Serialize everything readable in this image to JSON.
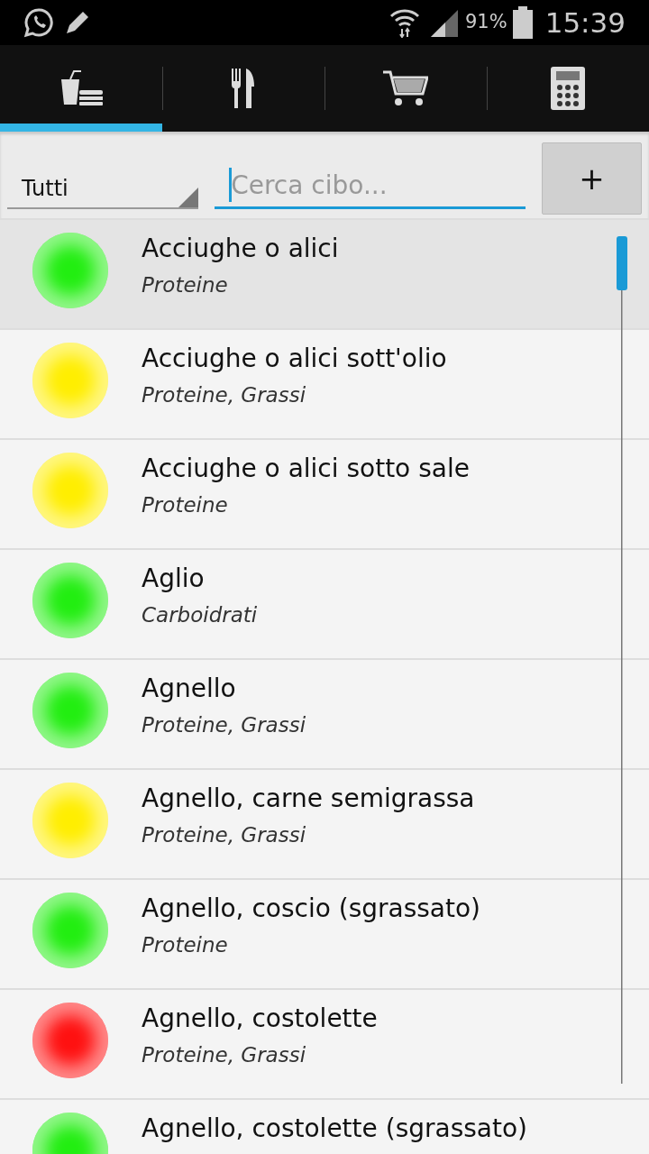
{
  "status_bar": {
    "battery": "91%",
    "time": "15:39"
  },
  "tabs": [
    {
      "selected": true
    },
    {
      "selected": false
    },
    {
      "selected": false
    },
    {
      "selected": false
    }
  ],
  "filter": {
    "value": "Tutti"
  },
  "search": {
    "placeholder": "Cerca cibo..."
  },
  "add_button": "+",
  "foods": [
    {
      "name": "Acciughe o alici",
      "category": "Proteine",
      "color": "#22ee11",
      "selected": true
    },
    {
      "name": "Acciughe o alici sott'olio",
      "category": "Proteine, Grassi",
      "color": "#ffee00",
      "selected": false
    },
    {
      "name": "Acciughe o alici sotto sale",
      "category": "Proteine",
      "color": "#ffee00",
      "selected": false
    },
    {
      "name": "Aglio",
      "category": "Carboidrati",
      "color": "#22ee11",
      "selected": false
    },
    {
      "name": "Agnello",
      "category": "Proteine, Grassi",
      "color": "#22ee11",
      "selected": false
    },
    {
      "name": "Agnello, carne semigrassa",
      "category": "Proteine, Grassi",
      "color": "#ffee00",
      "selected": false
    },
    {
      "name": "Agnello, coscio (sgrassato)",
      "category": "Proteine",
      "color": "#22ee11",
      "selected": false
    },
    {
      "name": "Agnello, costolette",
      "category": "Proteine, Grassi",
      "color": "#ff1111",
      "selected": false
    },
    {
      "name": "Agnello, costolette (sgrassato)",
      "color": "#22ee11",
      "selected": false
    }
  ]
}
